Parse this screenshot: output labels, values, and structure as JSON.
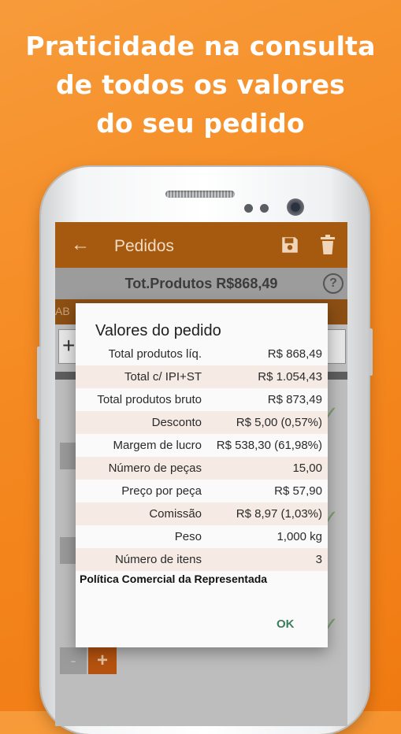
{
  "headline": [
    "Praticidade na consulta",
    "de todos os valores",
    "do seu pedido"
  ],
  "appbar": {
    "back_icon": "arrow-back-icon",
    "title": "Pedidos",
    "save_icon": "save-icon",
    "delete_icon": "trash-icon"
  },
  "totals_bar": {
    "text": "Tot.Produtos R$868,49",
    "help": "?"
  },
  "background": {
    "tab_fragment": "AB",
    "plus": "+",
    "minus": "-",
    "check": "✓"
  },
  "dialog": {
    "title": "Valores do pedido",
    "rows": [
      {
        "label": "Total produtos líq.",
        "value": "R$ 868,49"
      },
      {
        "label": "Total c/ IPI+ST",
        "value": "R$ 1.054,43"
      },
      {
        "label": "Total produtos bruto",
        "value": "R$ 873,49"
      },
      {
        "label": "Desconto",
        "value": "R$ 5,00 (0,57%)"
      },
      {
        "label": "Margem de lucro",
        "value": "R$ 538,30 (61,98%)"
      },
      {
        "label": "Número de peças",
        "value": "15,00"
      },
      {
        "label": "Preço por peça",
        "value": "R$ 57,90"
      },
      {
        "label": "Comissão",
        "value": "R$ 8,97 (1,03%)"
      },
      {
        "label": "Peso",
        "value": "1,000 kg"
      },
      {
        "label": "Número de itens",
        "value": "3"
      }
    ],
    "policy": "Política Comercial da Representada",
    "ok_label": "OK"
  },
  "colors": {
    "brand_orange": "#f58a22",
    "appbar": "#a55a10",
    "row_alt": "#f6ebe4",
    "ok": "#3d7d60"
  }
}
